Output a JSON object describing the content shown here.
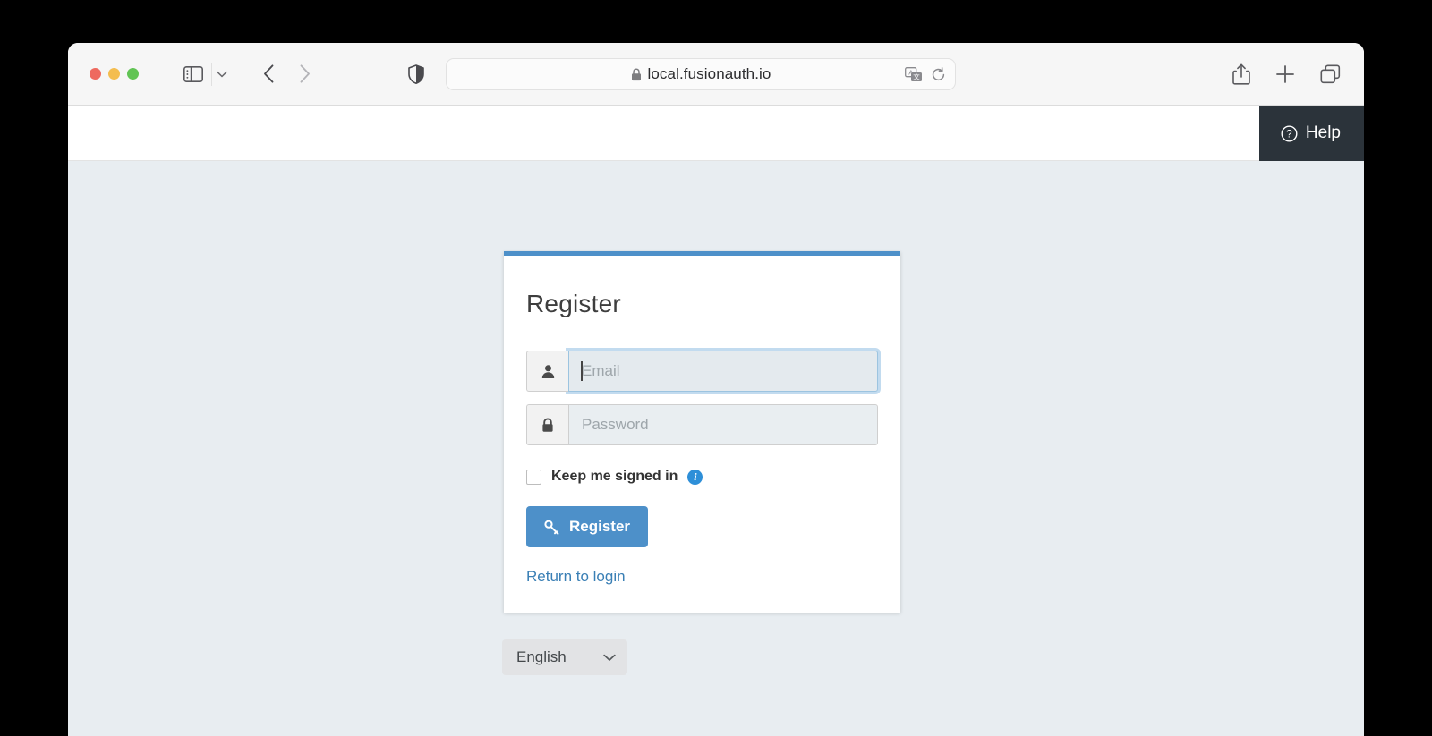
{
  "browser": {
    "traffic_lights": [
      "close",
      "minimize",
      "maximize"
    ],
    "sidebar_toggle_name": "sidebar-toggle",
    "back_label": "Back",
    "forward_label": "Forward",
    "shield_label": "Privacy Report",
    "address": {
      "url": "local.fusionauth.io",
      "placeholder": "Search or enter website name",
      "lock_icon": "lock-icon",
      "translate_icon": "translate-icon",
      "reload_icon": "reload-icon"
    },
    "right_icons": [
      "share-icon",
      "new-tab-icon",
      "tab-overview-icon"
    ]
  },
  "page": {
    "help": {
      "label": "Help",
      "icon": "question-circle-icon"
    },
    "card": {
      "title": "Register",
      "accent_color": "#4d90c9",
      "fields": [
        {
          "name": "email",
          "placeholder": "Email",
          "value": "",
          "icon": "user-icon",
          "focused": true
        },
        {
          "name": "password",
          "placeholder": "Password",
          "value": "",
          "icon": "lock-icon",
          "focused": false
        }
      ],
      "keep_signed_in": {
        "label": "Keep me signed in",
        "checked": false,
        "info_icon": "info-icon",
        "info_glyph": "i"
      },
      "submit": {
        "label": "Register",
        "icon": "key-icon",
        "color": "#4d90c9"
      },
      "return_link": "Return to login"
    },
    "language": {
      "selected": "English",
      "chevron_icon": "chevron-down-icon"
    },
    "background_color": "#e8edf1"
  }
}
